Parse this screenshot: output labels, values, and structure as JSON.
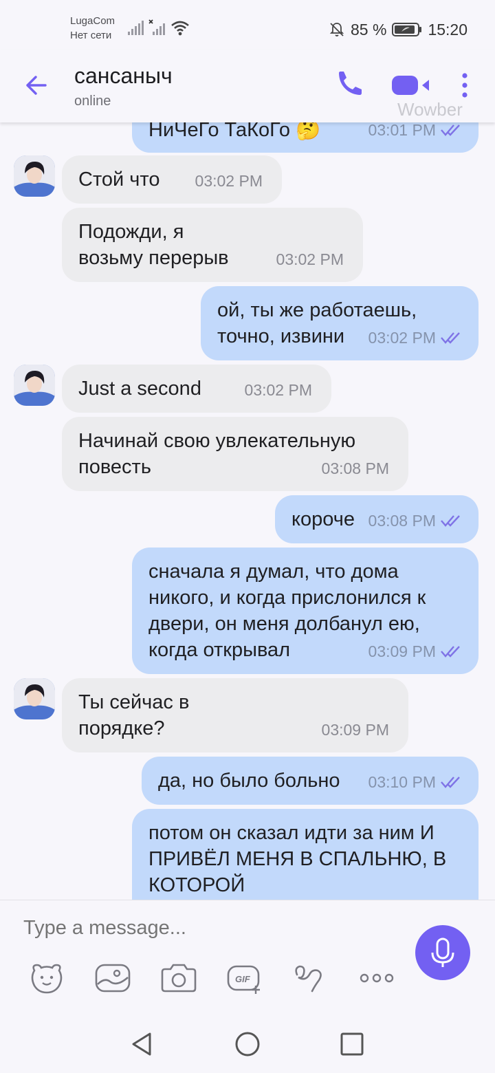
{
  "status_bar": {
    "carrier": "LugaCom",
    "network": "Нет сети",
    "battery": "85 %",
    "time": "15:20"
  },
  "header": {
    "contact_name": "сансаныч",
    "contact_status": "online",
    "watermark": "Wowber"
  },
  "messages": [
    {
      "dir": "out",
      "text": "НиЧеГо ТаКоГо 🤔",
      "time": "03:01 PM"
    },
    {
      "dir": "in",
      "text": "Стой что",
      "time": "03:02 PM"
    },
    {
      "dir": "in",
      "text": "Подожди, я возьму перерыв",
      "time": "03:02 PM"
    },
    {
      "dir": "out",
      "text": "ой, ты же работаешь, точно, извини",
      "time": "03:02 PM"
    },
    {
      "dir": "in",
      "text": "Just a second",
      "time": "03:02 PM"
    },
    {
      "dir": "in",
      "text": "Начинай свою увлекательную повесть",
      "time": "03:08 PM"
    },
    {
      "dir": "out",
      "text": "короче",
      "time": "03:08 PM"
    },
    {
      "dir": "out",
      "text": "сначала я думал, что дома никого, и когда прислонился к двери, он меня долбанул ею, когда открывал",
      "time": "03:09 PM"
    },
    {
      "dir": "in",
      "text": "Ты сейчас в порядке?",
      "time": "03:09 PM"
    },
    {
      "dir": "out",
      "text": "да, но было больно",
      "time": "03:10 PM"
    },
    {
      "dir": "out",
      "text": "потом он сказал идти за ним И ПРИВЁЛ МЕНЯ В СПАЛЬНЮ, В КОТОРОЙ",
      "time": ""
    }
  ],
  "composer": {
    "placeholder": "Type a message...",
    "tools": [
      "sticker-icon",
      "image-icon",
      "camera-icon",
      "gif-icon",
      "doodle-icon",
      "more-icon"
    ]
  },
  "theme": {
    "accent": "#7360f2",
    "incoming_bubble": "#ececee",
    "outgoing_bubble": "#c2d9fb"
  }
}
